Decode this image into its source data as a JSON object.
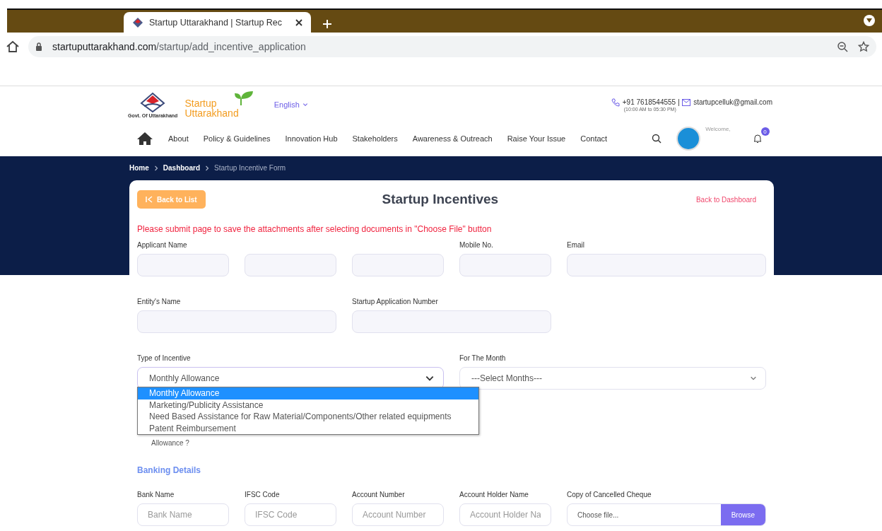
{
  "browser": {
    "tab_title": "Startup Uttarakhand | Startup Rec",
    "url_host": "startuputtarakhand.com",
    "url_path": "/startup/add_incentive_application"
  },
  "header": {
    "logo_line1": "Startup",
    "logo_line2": "Uttarakhand",
    "govt": "Govt. Of Uttarakhand",
    "language": "English",
    "phone": "+91 7618544555",
    "hours": "(10:00 AM to 05:30 PM)",
    "email": "startupcelluk@gmail.com",
    "nav": [
      "About",
      "Policy & Guidelines",
      "Innovation Hub",
      "Stakeholders",
      "Awareness & Outreach",
      "Raise Your Issue",
      "Contact"
    ],
    "welcome": "Welcome,",
    "notifications": "0"
  },
  "breadcrumb": [
    {
      "label": "Home",
      "current": false
    },
    {
      "label": "Dashboard",
      "current": false
    },
    {
      "label": "Startup Incentive Form",
      "current": true
    }
  ],
  "form": {
    "title": "Startup Incentives",
    "back_to_list": "Back to List",
    "back_to_dashboard": "Back to Dashboard",
    "notice": "Please submit page to save the attachments after selecting documents in \"Choose File\" button",
    "fields": [
      {
        "kind": "text",
        "label": "Applicant Name"
      },
      {
        "kind": "text"
      },
      {
        "kind": "text"
      },
      {
        "kind": "text",
        "label": "Mobile No."
      },
      {
        "kind": "text",
        "label": "Email"
      },
      {
        "kind": "text",
        "label": "Entity's Name"
      },
      {
        "kind": "text",
        "label": "Startup Application Number"
      },
      {
        "kind": "select",
        "label": "Type of Incentive",
        "value": "Monthly Allowance",
        "open": true
      },
      {
        "kind": "select",
        "label": "For The Month",
        "value": "---Select Months---",
        "open": false
      }
    ],
    "incentive_options": [
      {
        "label": "Monthly Allowance",
        "selected": true
      },
      {
        "label": "Marketing/Publicity Assistance",
        "selected": false
      },
      {
        "label": "Need Based Assistance for Raw Material/Components/Other related equipments",
        "selected": false
      },
      {
        "label": "Patent Reimbursement",
        "selected": false
      }
    ],
    "hidden_label": "Allowance ?",
    "banking_title": "Banking Details",
    "banking": [
      {
        "kind": "text",
        "label": "Bank Name",
        "placeholder": "Bank Name"
      },
      {
        "kind": "text",
        "label": "IFSC Code",
        "placeholder": "IFSC Code"
      },
      {
        "kind": "text",
        "label": "Account Number",
        "placeholder": "Account Number"
      },
      {
        "kind": "text",
        "label": "Account Holder Name",
        "placeholder": "Account Holder Na"
      },
      {
        "kind": "file",
        "label": "Copy of Cancelled Cheque",
        "placeholder": "Choose file...",
        "button": "Browse"
      }
    ]
  }
}
